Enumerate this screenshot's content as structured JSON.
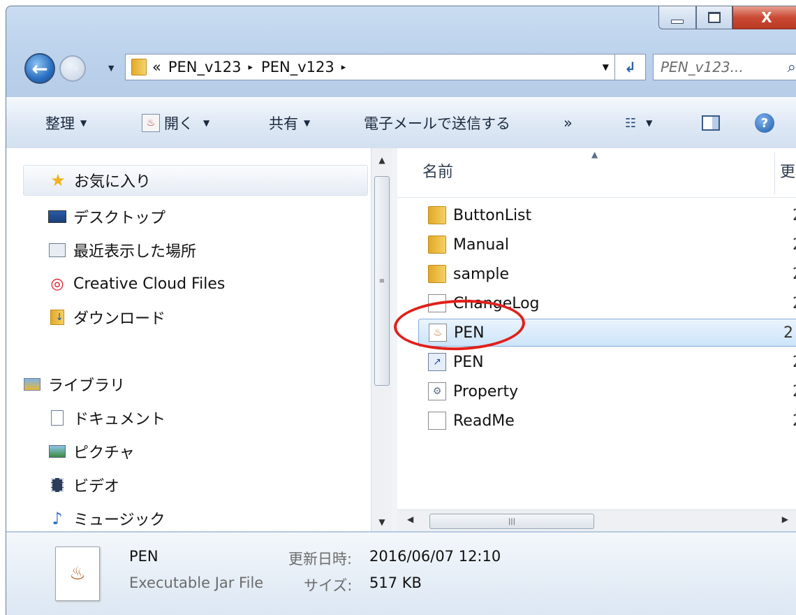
{
  "window": {
    "close_glyph": "X"
  },
  "address": {
    "overflow": "«",
    "segments": [
      "PEN_v123",
      "PEN_v123"
    ],
    "sep": "▸"
  },
  "search": {
    "placeholder": "PEN_v123..."
  },
  "toolbar": {
    "organize": "整理",
    "open": "開く",
    "share": "共有",
    "email": "電子メールで送信する",
    "more": "»"
  },
  "nav_pane": {
    "favorites": {
      "label": "お気に入り",
      "icon": "star-icon"
    },
    "favorite_items": [
      {
        "label": "デスクトップ",
        "icon": "desktop-icon"
      },
      {
        "label": "最近表示した場所",
        "icon": "recent-places-icon"
      },
      {
        "label": "Creative Cloud Files",
        "icon": "creative-cloud-icon"
      },
      {
        "label": "ダウンロード",
        "icon": "downloads-folder-icon"
      }
    ],
    "libraries": {
      "label": "ライブラリ",
      "icon": "library-icon"
    },
    "library_items": [
      {
        "label": "ドキュメント",
        "icon": "documents-icon"
      },
      {
        "label": "ピクチャ",
        "icon": "pictures-icon"
      },
      {
        "label": "ビデオ",
        "icon": "videos-icon"
      },
      {
        "label": "ミュージック",
        "icon": "music-icon"
      }
    ]
  },
  "file_list": {
    "columns": {
      "name": "名前",
      "next": "更"
    },
    "files": [
      {
        "name": "ButtonList",
        "type": "folder",
        "date_prefix": "2"
      },
      {
        "name": "Manual",
        "type": "folder",
        "date_prefix": "2"
      },
      {
        "name": "sample",
        "type": "folder",
        "date_prefix": "2"
      },
      {
        "name": "ChangeLog",
        "type": "text",
        "date_prefix": "2"
      },
      {
        "name": "PEN",
        "type": "jar",
        "date_prefix": "2",
        "selected": true
      },
      {
        "name": "PEN",
        "type": "shortcut",
        "date_prefix": "2"
      },
      {
        "name": "Property",
        "type": "config",
        "date_prefix": "2"
      },
      {
        "name": "ReadMe",
        "type": "text",
        "date_prefix": "2"
      }
    ]
  },
  "details": {
    "name": "PEN",
    "type": "Executable Jar File",
    "modified_label": "更新日時:",
    "modified_value": "2016/06/07 12:10",
    "size_label": "サイズ:",
    "size_value": "517 KB"
  },
  "colors": {
    "accent": "#2a6fbf",
    "annotation": "#e0201b",
    "selection": "#cde4fa"
  }
}
